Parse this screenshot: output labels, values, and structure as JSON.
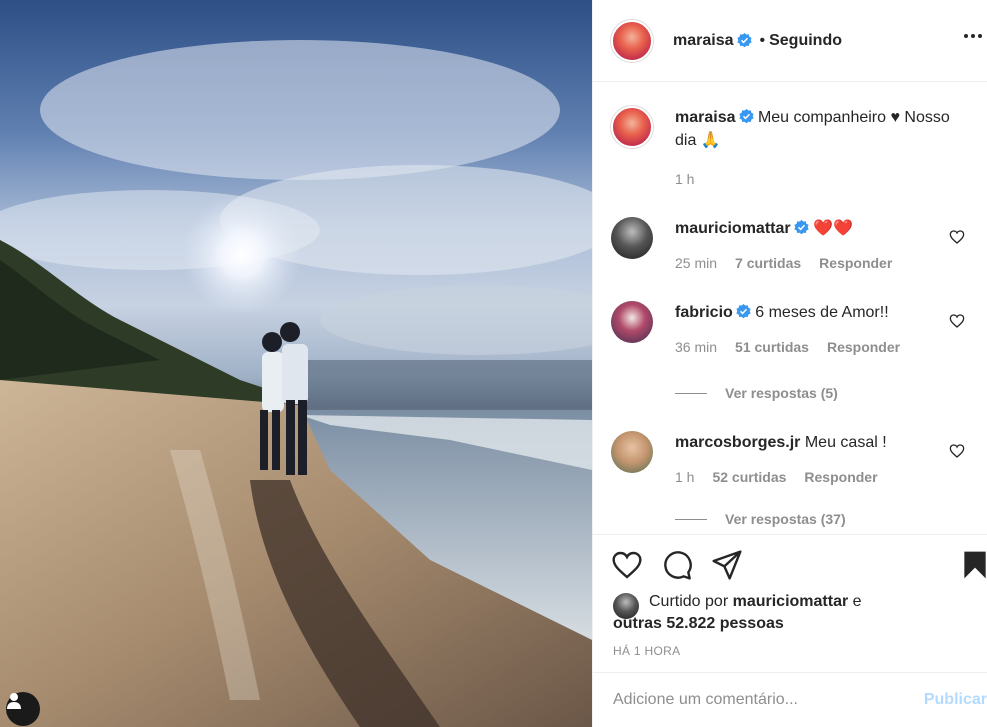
{
  "post": {
    "author": "maraisa",
    "follow_state": "Seguindo",
    "separator": "•",
    "caption": "Meu companheiro ♥ Nosso dia 🙏",
    "caption_time": "1 h"
  },
  "comments": [
    {
      "user": "mauriciomattar",
      "verified": true,
      "text": "❤️❤️",
      "time": "25 min",
      "likes": "7 curtidas",
      "reply_label": "Responder"
    },
    {
      "user": "fabricio",
      "verified": true,
      "text": "6 meses de Amor!!",
      "time": "36 min",
      "likes": "51 curtidas",
      "reply_label": "Responder",
      "view_replies": "Ver respostas (5)"
    },
    {
      "user": "marcosborges.jr",
      "verified": false,
      "text": "Meu casal !",
      "time": "1 h",
      "likes": "52 curtidas",
      "reply_label": "Responder",
      "view_replies": "Ver respostas (37)"
    }
  ],
  "liked_by": {
    "prefix": "Curtido por",
    "user": "mauriciomattar",
    "conjunction": "e",
    "others": "outras 52.822 pessoas"
  },
  "timestamp": "HÁ 1 HORA",
  "add_comment": {
    "placeholder": "Adicione um comentário...",
    "publish_label": "Publicar"
  },
  "icons": {
    "verified": "verified-badge-icon",
    "more": "more-options-icon",
    "like": "heart-icon",
    "comment": "comment-icon",
    "share": "share-icon",
    "save": "bookmark-icon",
    "tag": "user-tag-icon"
  },
  "colors": {
    "verified_blue": "#3897f0",
    "publish_disabled": "#b3dbff",
    "muted_text": "#8e8e8e",
    "border": "#efefef"
  }
}
